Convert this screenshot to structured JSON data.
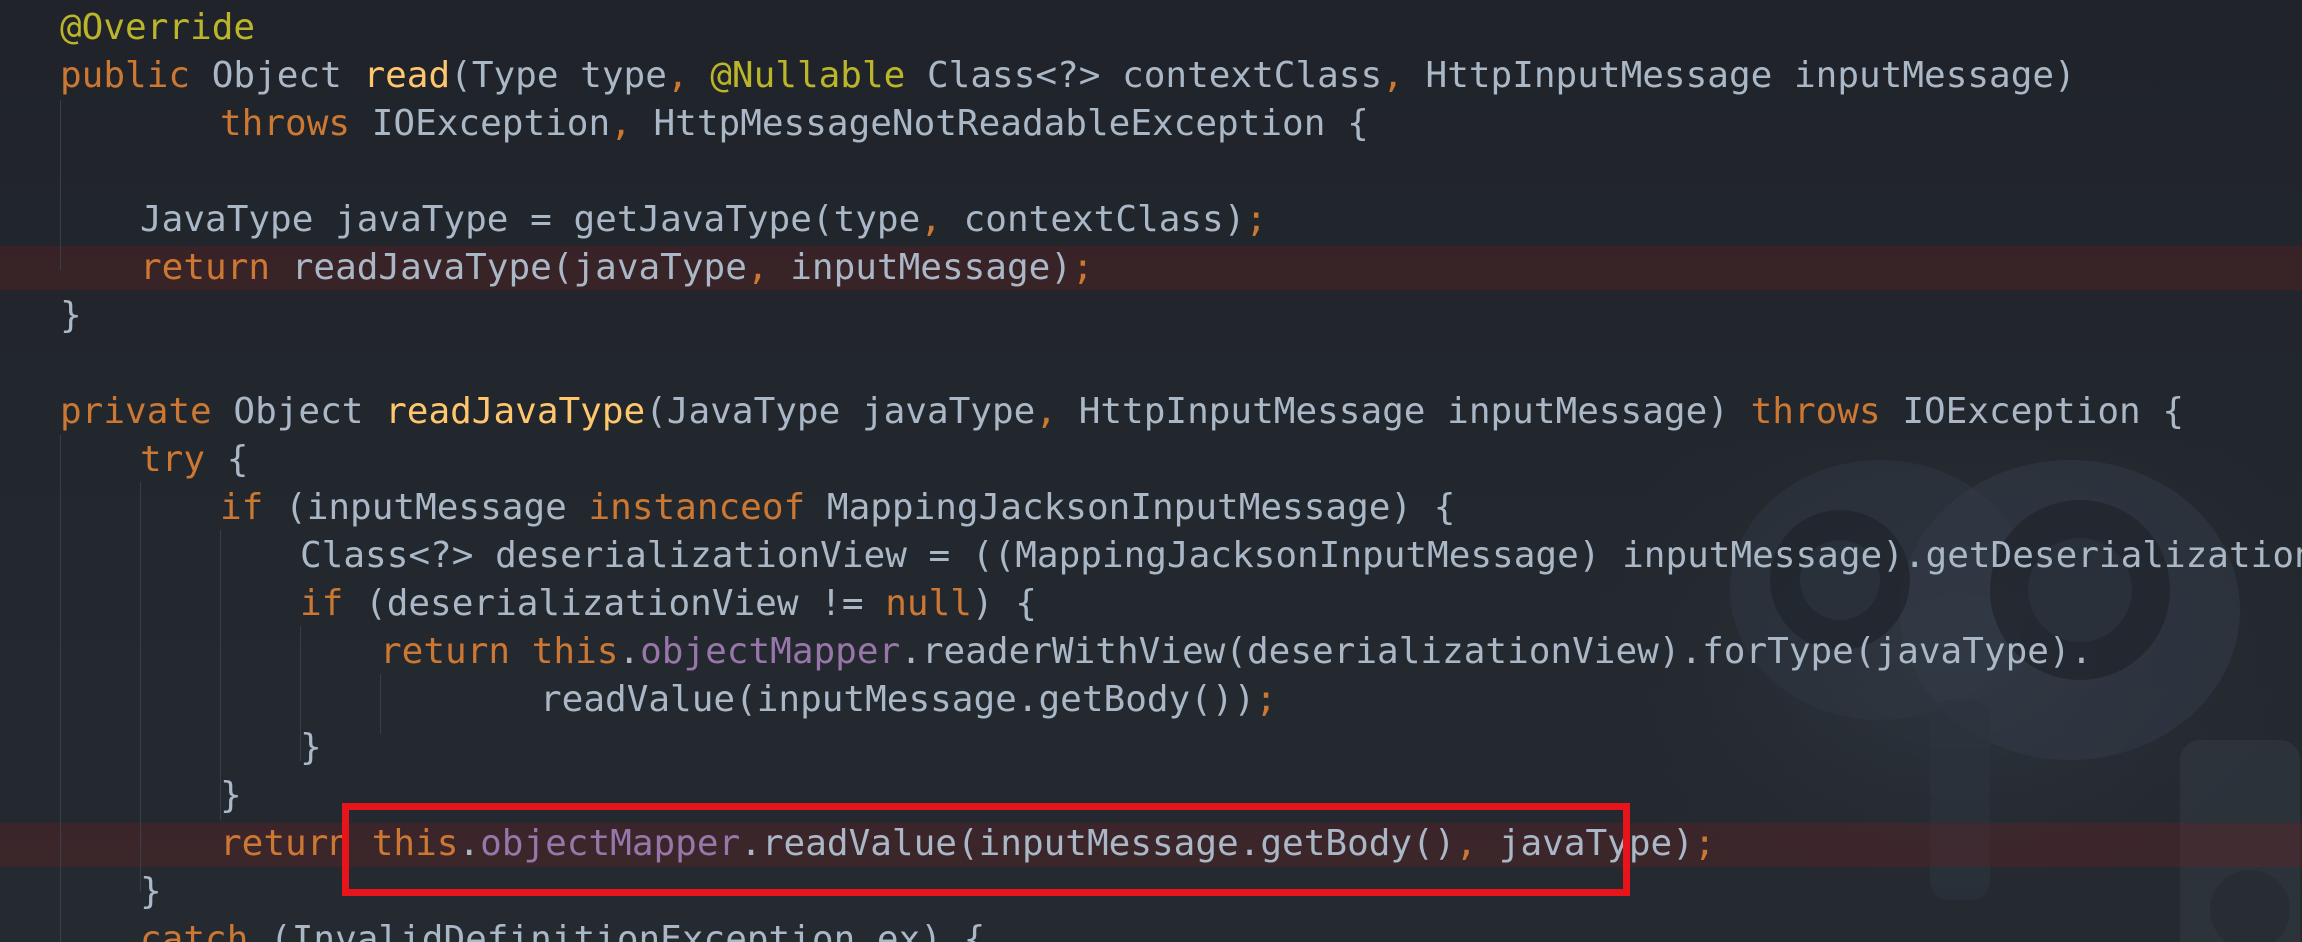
{
  "code": {
    "lines": [
      [
        {
          "t": "@Override",
          "c": "annotation"
        }
      ],
      [
        {
          "t": "public",
          "c": "kw"
        },
        {
          "t": " Object ",
          "c": "plain"
        },
        {
          "t": "read",
          "c": "method"
        },
        {
          "t": "(Type type",
          "c": "plain"
        },
        {
          "t": ", ",
          "c": "punct"
        },
        {
          "t": "@Nullable",
          "c": "annotation"
        },
        {
          "t": " Class<?> contextClass",
          "c": "plain"
        },
        {
          "t": ", ",
          "c": "punct"
        },
        {
          "t": "HttpInputMessage inputMessage)",
          "c": "plain"
        }
      ],
      [
        {
          "t": "throws",
          "c": "kw"
        },
        {
          "t": " IOException",
          "c": "plain"
        },
        {
          "t": ", ",
          "c": "punct"
        },
        {
          "t": "HttpMessageNotReadableException {",
          "c": "plain"
        }
      ],
      [],
      [
        {
          "t": "JavaType javaType = getJavaType(type",
          "c": "plain"
        },
        {
          "t": ", ",
          "c": "punct"
        },
        {
          "t": "contextClass)",
          "c": "plain"
        },
        {
          "t": ";",
          "c": "punct"
        }
      ],
      [
        {
          "t": "return",
          "c": "kw"
        },
        {
          "t": " readJavaType(javaType",
          "c": "plain"
        },
        {
          "t": ", ",
          "c": "punct"
        },
        {
          "t": "inputMessage)",
          "c": "plain"
        },
        {
          "t": ";",
          "c": "punct"
        }
      ],
      [
        {
          "t": "}",
          "c": "plain"
        }
      ],
      [],
      [
        {
          "t": "private",
          "c": "kw"
        },
        {
          "t": " Object ",
          "c": "plain"
        },
        {
          "t": "readJavaType",
          "c": "method"
        },
        {
          "t": "(JavaType javaType",
          "c": "plain"
        },
        {
          "t": ", ",
          "c": "punct"
        },
        {
          "t": "HttpInputMessage inputMessage) ",
          "c": "plain"
        },
        {
          "t": "throws",
          "c": "kw"
        },
        {
          "t": " IOException {",
          "c": "plain"
        }
      ],
      [
        {
          "t": "try",
          "c": "kw"
        },
        {
          "t": " {",
          "c": "plain"
        }
      ],
      [
        {
          "t": "if",
          "c": "kw"
        },
        {
          "t": " (inputMessage ",
          "c": "plain"
        },
        {
          "t": "instanceof",
          "c": "kw"
        },
        {
          "t": " MappingJacksonInputMessage) {",
          "c": "plain"
        }
      ],
      [
        {
          "t": "Class<?> deserializationView = ((MappingJacksonInputMessage) inputMessage).getDeserializationView()",
          "c": "plain"
        },
        {
          "t": ";",
          "c": "punct"
        }
      ],
      [
        {
          "t": "if",
          "c": "kw"
        },
        {
          "t": " (deserializationView != ",
          "c": "plain"
        },
        {
          "t": "null",
          "c": "kw"
        },
        {
          "t": ") {",
          "c": "plain"
        }
      ],
      [
        {
          "t": "return this",
          "c": "kw"
        },
        {
          "t": ".",
          "c": "plain"
        },
        {
          "t": "objectMapper",
          "c": "field"
        },
        {
          "t": ".readerWithView(deserializationView).forType(javaType).",
          "c": "plain"
        }
      ],
      [
        {
          "t": "readValue(inputMessage.getBody())",
          "c": "plain"
        },
        {
          "t": ";",
          "c": "punct"
        }
      ],
      [
        {
          "t": "}",
          "c": "plain"
        }
      ],
      [
        {
          "t": "}",
          "c": "plain"
        }
      ],
      [
        {
          "t": "return ",
          "c": "kw"
        },
        {
          "t": "this",
          "c": "kw"
        },
        {
          "t": ".",
          "c": "plain"
        },
        {
          "t": "objectMapper",
          "c": "field"
        },
        {
          "t": ".readValue(inputMessage.getBody()",
          "c": "plain"
        },
        {
          "t": ", ",
          "c": "punct"
        },
        {
          "t": "javaType)",
          "c": "plain"
        },
        {
          "t": ";",
          "c": "punct"
        }
      ],
      [
        {
          "t": "}",
          "c": "plain"
        }
      ],
      [
        {
          "t": "catch",
          "c": "kw"
        },
        {
          "t": " (InvalidDefinitionException ex) {",
          "c": "plain"
        }
      ]
    ]
  },
  "colors": {
    "background": "#22262c",
    "keyword": "#cc7832",
    "method": "#ffc66d",
    "annotation": "#bbb529",
    "field": "#9876aa",
    "text": "#a9b7c6",
    "highlight_box": "#e8141b"
  }
}
